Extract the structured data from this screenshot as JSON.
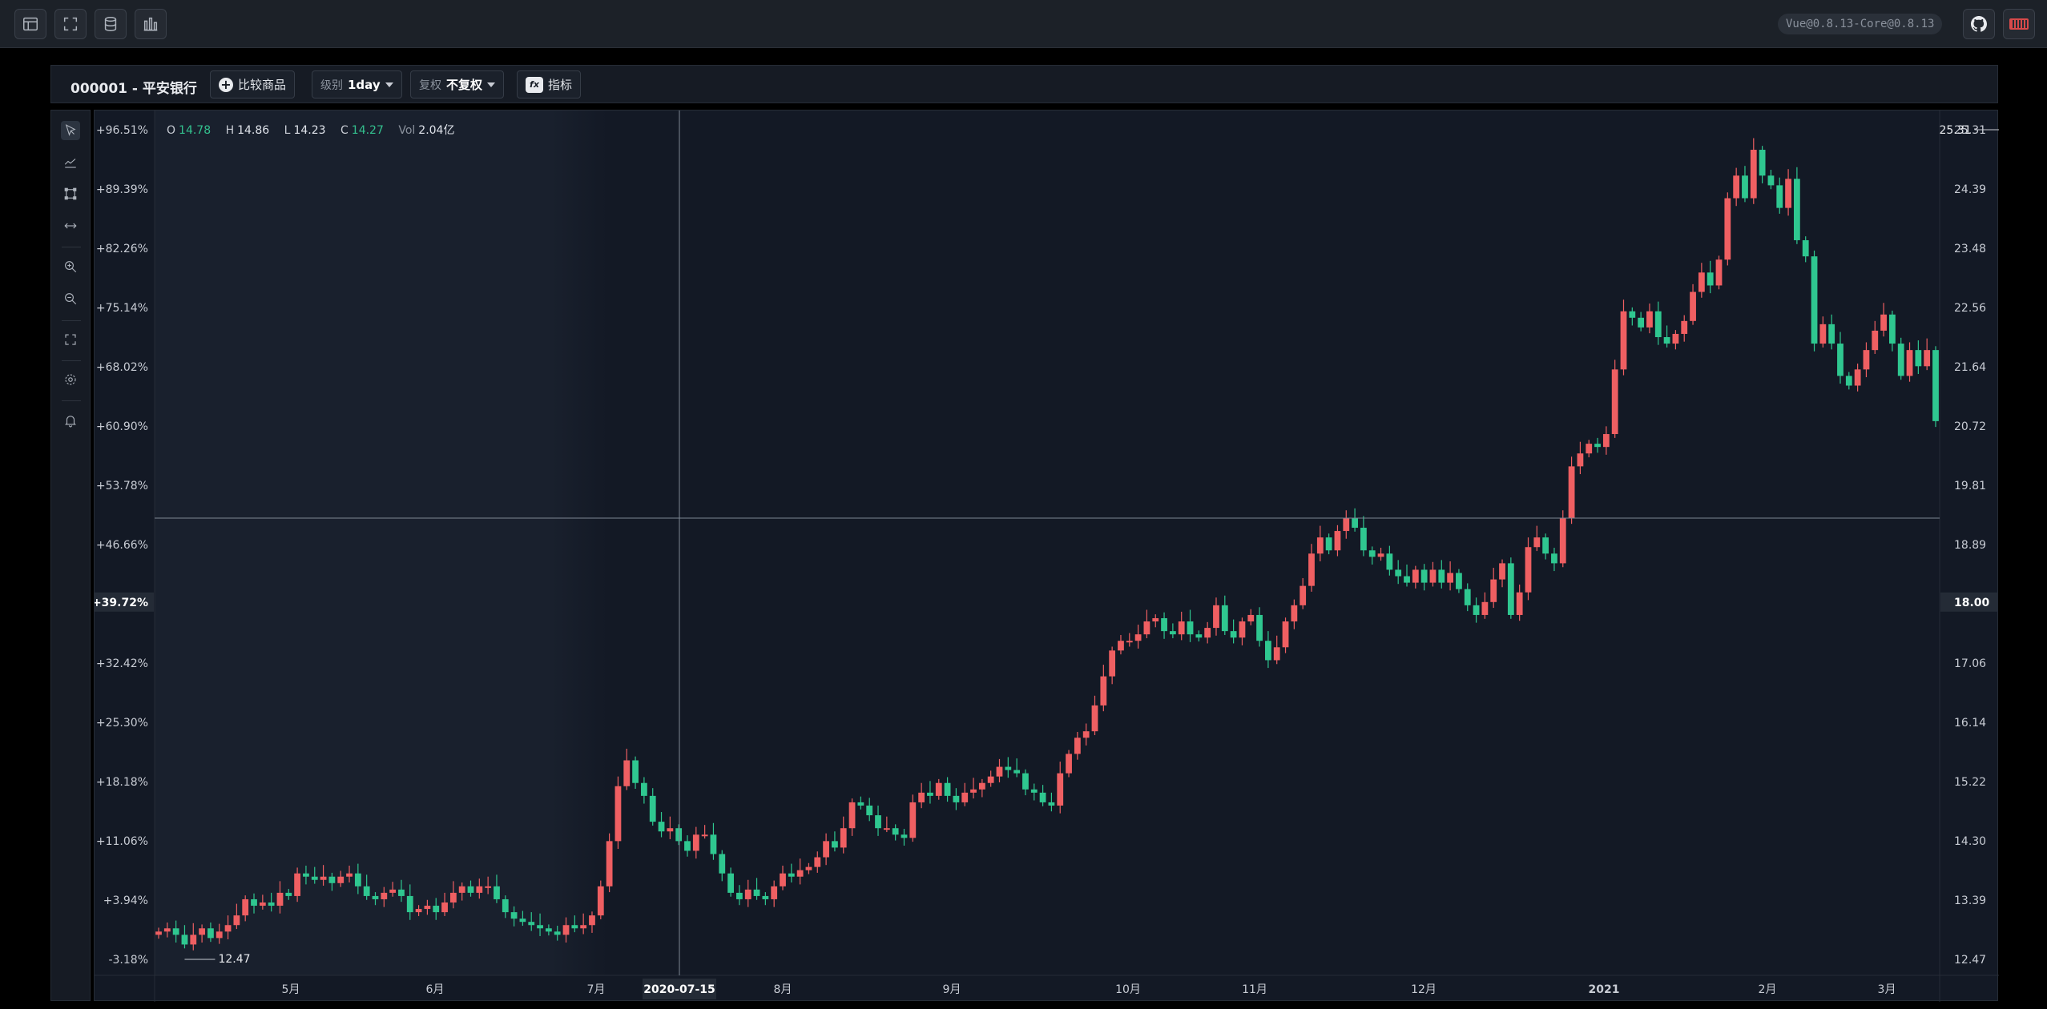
{
  "topbar": {
    "icons": [
      "table-icon",
      "fullscreen-icon",
      "database-icon",
      "bar-chart-icon"
    ],
    "version": "Vue@0.8.13-Core@0.8.13"
  },
  "symbol_bar": {
    "symbol": "000001 - 平安银行",
    "compare_label": "比较商品",
    "period_label": "级别",
    "period_value": "1day",
    "adjust_label": "复权",
    "adjust_value": "不复权",
    "indicator_label": "指标"
  },
  "legend": {
    "o_label": "O",
    "o_value": "14.78",
    "h_label": "H",
    "h_value": "14.86",
    "l_label": "L",
    "l_value": "14.23",
    "c_label": "C",
    "c_value": "14.27",
    "vol_label": "Vol",
    "vol_value": "2.04亿"
  },
  "colors": {
    "up": "#ef5f62",
    "down": "#2fc790",
    "background": "#131925",
    "shaded_region": "#19202d"
  },
  "crosshair": {
    "date": "2020-07-15",
    "price": "18.00",
    "percent": "+39.72%"
  },
  "chart_data": {
    "type": "candlestick",
    "title": "",
    "x_tick_labels": [
      "5月",
      "6月",
      "7月",
      "8月",
      "9月",
      "10月",
      "11月",
      "12月",
      "2021",
      "2月",
      "3月"
    ],
    "y_right_ticks": [
      "25.31",
      "24.39",
      "23.48",
      "22.56",
      "21.64",
      "20.72",
      "19.81",
      "18.89",
      "17.97",
      "17.06",
      "16.14",
      "15.22",
      "14.30",
      "13.39",
      "12.47"
    ],
    "y_left_ticks": [
      "+96.51%",
      "+89.39%",
      "+82.26%",
      "+75.14%",
      "+68.02%",
      "+60.90%",
      "+53.78%",
      "+46.66%",
      "+39.54%",
      "+32.42%",
      "+25.30%",
      "+18.18%",
      "+11.06%",
      "+3.94%",
      "-3.18%"
    ],
    "ylim": [
      12.47,
      25.31
    ],
    "max_label": "25.31",
    "min_label": "12.47",
    "series": [
      {
        "name": "",
        "close": [
          12.9,
          12.95,
          12.85,
          12.7,
          12.85,
          12.95,
          12.8,
          12.9,
          13.0,
          13.15,
          13.4,
          13.3,
          13.35,
          13.3,
          13.5,
          13.45,
          13.8,
          13.75,
          13.7,
          13.75,
          13.65,
          13.75,
          13.8,
          13.6,
          13.45,
          13.4,
          13.5,
          13.55,
          13.45,
          13.2,
          13.25,
          13.3,
          13.2,
          13.35,
          13.5,
          13.6,
          13.5,
          13.6,
          13.6,
          13.4,
          13.2,
          13.1,
          13.05,
          13.0,
          12.95,
          12.9,
          12.85,
          13.0,
          12.95,
          13.0,
          13.15,
          13.6,
          14.3,
          15.15,
          15.55,
          15.2,
          15.0,
          14.6,
          14.45,
          14.5,
          14.3,
          14.15,
          14.4,
          14.4,
          14.1,
          13.8,
          13.5,
          13.4,
          13.55,
          13.45,
          13.4,
          13.6,
          13.8,
          13.75,
          13.85,
          13.9,
          14.05,
          14.3,
          14.2,
          14.5,
          14.9,
          14.85,
          14.7,
          14.5,
          14.5,
          14.4,
          14.35,
          14.9,
          15.05,
          15.0,
          15.2,
          15.0,
          14.9,
          15.05,
          15.1,
          15.2,
          15.3,
          15.45,
          15.4,
          15.35,
          15.1,
          15.05,
          14.9,
          14.85,
          15.35,
          15.65,
          15.9,
          16.0,
          16.4,
          16.85,
          17.25,
          17.4,
          17.4,
          17.5,
          17.7,
          17.75,
          17.55,
          17.5,
          17.7,
          17.5,
          17.45,
          17.6,
          17.95,
          17.55,
          17.45,
          17.7,
          17.8,
          17.4,
          17.1,
          17.3,
          17.7,
          17.95,
          18.25,
          18.75,
          19.0,
          18.8,
          19.1,
          19.3,
          19.15,
          18.8,
          18.7,
          18.75,
          18.5,
          18.4,
          18.3,
          18.5,
          18.3,
          18.5,
          18.3,
          18.45,
          18.2,
          17.95,
          17.8,
          18.0,
          18.35,
          18.6,
          17.8,
          18.15,
          18.85,
          19.0,
          18.75,
          18.6,
          19.3,
          20.1,
          20.3,
          20.45,
          20.4,
          20.6,
          21.6,
          22.5,
          22.4,
          22.25,
          22.5,
          22.1,
          22.0,
          22.15,
          22.35,
          22.8,
          23.1,
          22.9,
          23.3,
          24.25,
          24.6,
          24.25,
          25.0,
          24.6,
          24.45,
          24.1,
          24.55,
          23.6,
          23.35,
          22.0,
          22.3,
          22.0,
          21.5,
          21.35,
          21.6,
          21.9,
          22.2,
          22.45,
          22.0,
          21.5,
          21.9,
          21.65,
          21.9,
          20.8
        ]
      }
    ]
  }
}
